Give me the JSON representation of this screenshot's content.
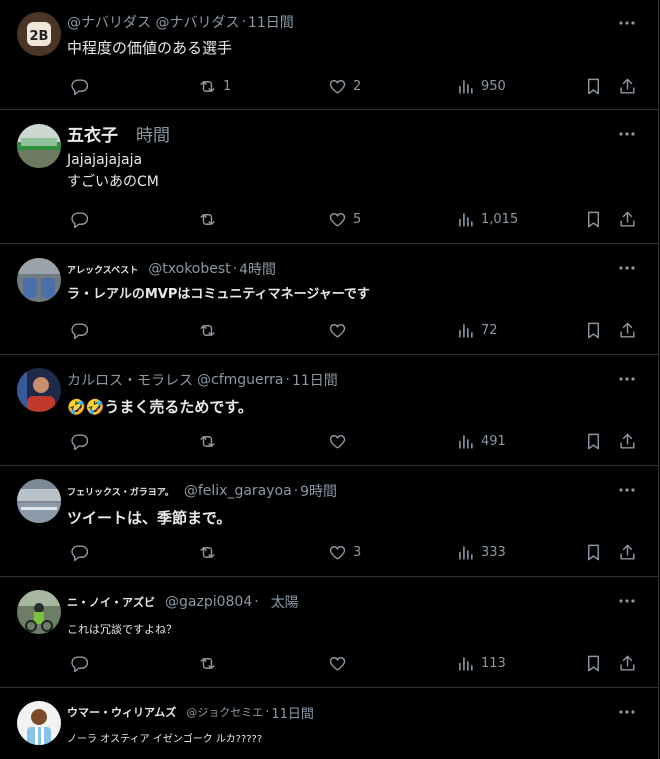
{
  "tweets": [
    {
      "name": "",
      "handle": "@ナバリダス @ナバリダス",
      "time": "11日間",
      "text": "中程度の価値のある選手",
      "reply_count": "",
      "retweet_count": "1",
      "like_count": "2",
      "view_count": "950",
      "avatar": "dark-badge-avatar"
    },
    {
      "name": "五衣子",
      "handle": "",
      "time": "時間",
      "text": " Jajajajajaja\nすごいあのCM",
      "reply_count": "",
      "retweet_count": "",
      "like_count": "5",
      "view_count": "1,015",
      "avatar": "train-avatar"
    },
    {
      "name": "アレックスベスト",
      "handle": "@txokobest",
      "time": "4時間",
      "text": "ラ・レアルのMVPはコミュニティマネージャーです",
      "reply_count": "",
      "retweet_count": "",
      "like_count": "",
      "view_count": "72",
      "avatar": "shoes-avatar"
    },
    {
      "name": "カルロス・モラレス",
      "handle": "@cfmguerra",
      "time": "11日間",
      "text": "🤣🤣うまく売るためです。",
      "reply_count": "",
      "retweet_count": "",
      "like_count": "",
      "view_count": "491",
      "avatar": "person-avatar"
    },
    {
      "name": "フェリックス・ガラヨア。",
      "handle": "@felix_garayoa",
      "time": "9時間",
      "text": "ツイートは、季節まで。",
      "reply_count": "",
      "retweet_count": "",
      "like_count": "3",
      "view_count": "333",
      "avatar": "stadium-avatar"
    },
    {
      "name": "ニ・ノイ・アズビ",
      "handle": "@gazpi0804",
      "time": "太陽",
      "text": "これは冗談ですよね？",
      "reply_count": "",
      "retweet_count": "",
      "like_count": "",
      "view_count": "113",
      "avatar": "cyclist-avatar"
    },
    {
      "name": "ウマー・ウィリアムズ",
      "handle": "@ジョクセミエ",
      "time": "11日間",
      "text": "ノーラ オスティア イゼンゴーク ルカ?????",
      "reply_count": "",
      "retweet_count": "",
      "like_count": "",
      "view_count": "",
      "avatar": "jersey-avatar"
    }
  ],
  "icons": {
    "reply": "reply-icon",
    "retweet": "retweet-icon",
    "like": "heart-icon",
    "views": "views-icon",
    "bookmark": "bookmark-icon",
    "share": "share-icon",
    "more": "more-icon"
  },
  "colors": {
    "background": "#000000",
    "text": "#e7e9ea",
    "muted": "#8b98a5",
    "border": "#2f3336"
  }
}
